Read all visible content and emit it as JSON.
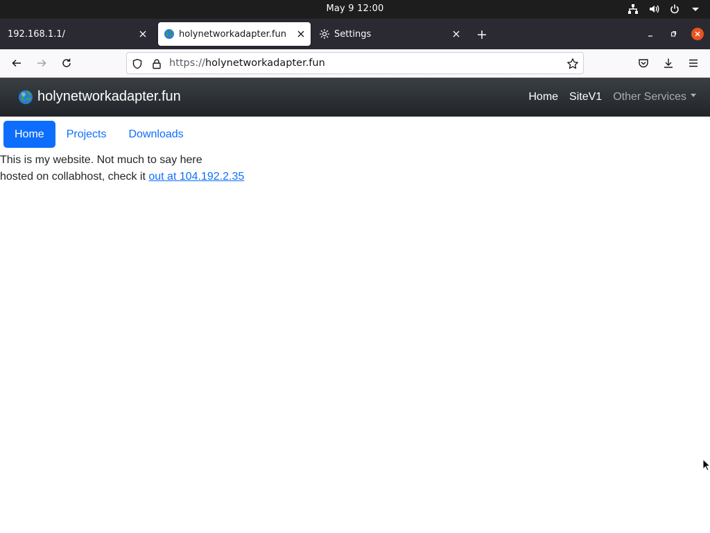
{
  "system": {
    "clock": "May 9  12:00",
    "icons": [
      "network-icon",
      "volume-icon",
      "power-icon",
      "chevron-down-icon"
    ]
  },
  "browser": {
    "tabs": [
      {
        "title": "192.168.1.1/",
        "active": false
      },
      {
        "title": "holynetworkadapter.fun",
        "active": true
      },
      {
        "title": "Settings",
        "active": false
      }
    ],
    "url_scheme": "https://",
    "url_host": "holynetworkadapter.fun"
  },
  "site": {
    "brand": "holynetworkadapter.fun",
    "nav": {
      "home": "Home",
      "sitev1": "SiteV1",
      "other": "Other Services"
    },
    "pills": {
      "home": "Home",
      "projects": "Projects",
      "downloads": "Downloads"
    },
    "content": {
      "line1": "This is my website. Not much to say here",
      "line2_prefix": "hosted on collabhost, check it ",
      "link": "out at 104.192.2.35"
    }
  },
  "colors": {
    "accent": "#0d6efd",
    "header_dark": "#212529",
    "tabstrip": "#2b2a33",
    "close_button": "#e95420"
  }
}
